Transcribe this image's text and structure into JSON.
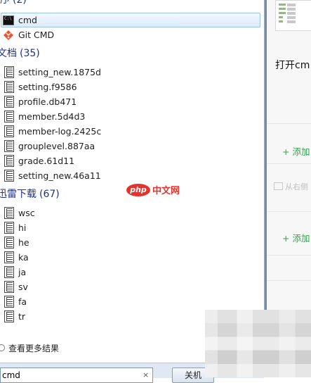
{
  "groups": [
    {
      "title": "程序",
      "count": "(2)",
      "items": [
        {
          "label": "cmd",
          "icon": "cmd-icon"
        },
        {
          "label": "Git CMD",
          "icon": "git-icon"
        }
      ]
    },
    {
      "title": "文档",
      "count": "(35)",
      "items": [
        {
          "label": "setting_new.1875d",
          "icon": "document-icon"
        },
        {
          "label": "setting.f9586",
          "icon": "document-icon"
        },
        {
          "label": "profile.db471",
          "icon": "document-icon"
        },
        {
          "label": "member.5d4d3",
          "icon": "document-icon"
        },
        {
          "label": "member-log.2425c",
          "icon": "document-icon"
        },
        {
          "label": "grouplevel.887aa",
          "icon": "document-icon"
        },
        {
          "label": "grade.61d11",
          "icon": "document-icon"
        },
        {
          "label": "setting_new.46a11",
          "icon": "document-icon"
        }
      ]
    },
    {
      "title": "迅雷下载",
      "count": "(67)",
      "items": [
        {
          "label": "wsc",
          "icon": "document-icon"
        },
        {
          "label": "hi",
          "icon": "document-icon"
        },
        {
          "label": "he",
          "icon": "document-icon"
        },
        {
          "label": "ka",
          "icon": "document-icon"
        },
        {
          "label": "ja",
          "icon": "document-icon"
        },
        {
          "label": "sv",
          "icon": "document-icon"
        },
        {
          "label": "fa",
          "icon": "document-icon"
        },
        {
          "label": "tr",
          "icon": "document-icon"
        }
      ]
    }
  ],
  "more_results": "查看更多结果",
  "search": {
    "value": "cmd",
    "clear_glyph": "×"
  },
  "shutdown_label": "关机",
  "right_pane": {
    "open_text": "打开cm",
    "add_label_1": "+ 添加",
    "from_right_text": "从右侧",
    "add_label_2": "+ 添加"
  },
  "watermark": {
    "logo_text": "php",
    "site_text": "中文网"
  },
  "colors": {
    "group_header": "#1e3287",
    "selection_border": "#99c4f0",
    "add_link": "#2ea84a",
    "watermark": "#e5322d"
  }
}
